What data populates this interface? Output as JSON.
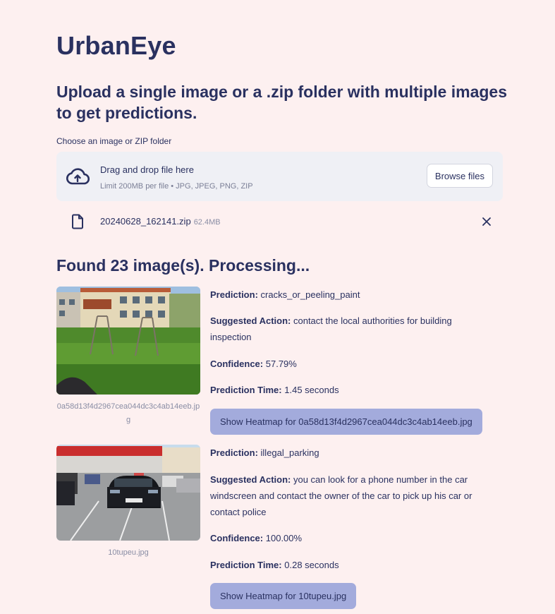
{
  "app": {
    "title": "UrbanEye",
    "subtitle": "Upload a single image or a .zip folder with multiple images to get predictions."
  },
  "uploader": {
    "label": "Choose an image or ZIP folder",
    "drop_text": "Drag and drop file here",
    "limit_text": "Limit 200MB per file • JPG, JPEG, PNG, ZIP",
    "browse_label": "Browse files",
    "icon": "cloud-upload-icon",
    "file": {
      "name": "20240628_162141.zip",
      "size": "62.4MB",
      "icon": "file-icon"
    }
  },
  "status": "Found 23 image(s). Processing...",
  "labels": {
    "prediction": "Prediction:",
    "action": "Suggested Action:",
    "confidence": "Confidence:",
    "time": "Prediction Time:"
  },
  "results": [
    {
      "caption": "0a58d13f4d2967cea044dc3c4ab14eeb.jpg",
      "prediction": "cracks_or_peeling_paint",
      "action": "contact the local authorities for building inspection",
      "confidence": "57.79%",
      "time": "1.45 seconds",
      "button": "Show Heatmap for 0a58d13f4d2967cea044dc3c4ab14eeb.jpg"
    },
    {
      "caption": "10tupeu.jpg",
      "prediction": "illegal_parking",
      "action": "you can look for a phone number in the car windscreen and contact the owner of the car to pick up his car or contact police",
      "confidence": "100.00%",
      "time": "0.28 seconds",
      "button": "Show Heatmap for 10tupeu.jpg"
    }
  ],
  "colors": {
    "background": "#fdf0f0",
    "text": "#2a3160",
    "button": "#a3abdc",
    "dropzone": "#eff0f5"
  }
}
